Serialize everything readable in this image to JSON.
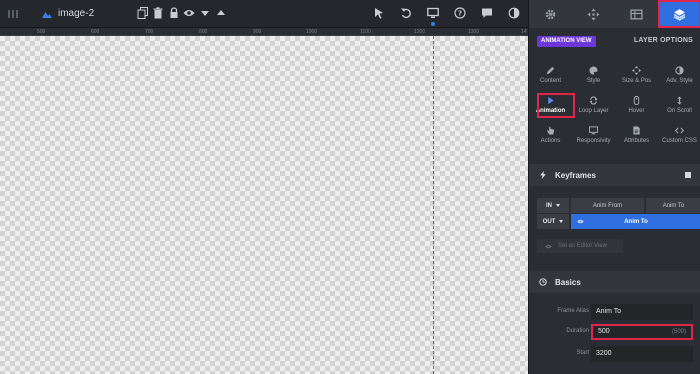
{
  "toolbar": {
    "layer_title": "image-2"
  },
  "ruler": {
    "ticks": [
      "500",
      "600",
      "700",
      "800",
      "900",
      "1000",
      "1100",
      "1200",
      "1300",
      "14"
    ]
  },
  "panel": {
    "tabs": [
      {
        "icon": "gear-icon"
      },
      {
        "icon": "move-icon"
      },
      {
        "icon": "media-icon"
      },
      {
        "icon": "layers-icon",
        "active": true
      }
    ],
    "view_badge": "ANIMATION VIEW",
    "layer_options_label": "LAYER OPTIONS",
    "grid": [
      {
        "label": "Content",
        "icon": "pencil-icon"
      },
      {
        "label": "Style",
        "icon": "palette-icon"
      },
      {
        "label": "Size & Pos",
        "icon": "arrows-icon"
      },
      {
        "label": "Adv. Style",
        "icon": "contrast-icon"
      },
      {
        "label": "Animation",
        "icon": "play-icon",
        "selected": true
      },
      {
        "label": "Loop Layer",
        "icon": "loop-icon"
      },
      {
        "label": "Hover",
        "icon": "mouse-icon"
      },
      {
        "label": "On Scroll",
        "icon": "scroll-icon"
      },
      {
        "label": "Actions",
        "icon": "hand-icon"
      },
      {
        "label": "Responsivity",
        "icon": "monitor-icon"
      },
      {
        "label": "Attributes",
        "icon": "document-icon"
      },
      {
        "label": "Custom CSS",
        "icon": "code-icon"
      }
    ],
    "keyframes": {
      "title": "Keyframes",
      "in_label": "IN",
      "out_label": "OUT",
      "anim_from": "Anim From",
      "anim_to": "Anim To",
      "active_frame": "Anim To",
      "editor_view_btn": "Set as Editor View"
    },
    "basics": {
      "title": "Basics",
      "fields": {
        "frame_alias": {
          "label": "Frame Alias",
          "value": "Anim To"
        },
        "duration": {
          "label": "Duration",
          "value": "500",
          "hint": "(500)"
        },
        "start": {
          "label": "Start",
          "value": "3200"
        }
      }
    }
  }
}
